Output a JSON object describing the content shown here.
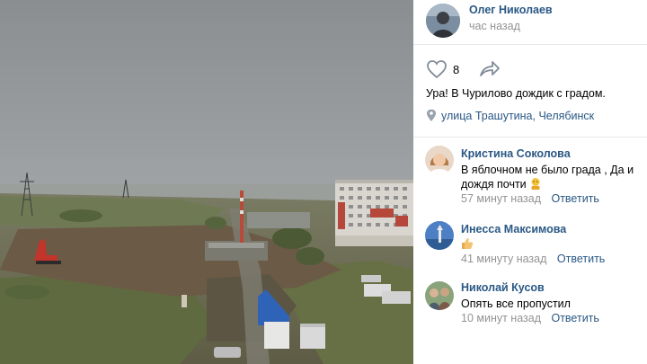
{
  "post": {
    "author_name": "Олег Николаев",
    "time": "час назад",
    "likes": "8",
    "text": "Ура! В Чурилово дождик с градом.",
    "location": "улица Трашутина, Челябинск"
  },
  "comments": [
    {
      "name": "Кристина Соколова",
      "text": "В яблочном не было града , Да и дождя почти",
      "emoji": "face-emoji",
      "time": "57 минут назад",
      "reply": "Ответить"
    },
    {
      "name": "Инесса Максимова",
      "text": "",
      "emoji": "thumbs-up-emoji",
      "time": "41 минуту назад",
      "reply": "Ответить"
    },
    {
      "name": "Николай Кусов",
      "text": "Опять все пропустил",
      "time": "10 минут назад",
      "reply": "Ответить"
    }
  ],
  "colors": {
    "link": "#2a5885",
    "muted": "#939393",
    "divider": "#e7e8ec"
  }
}
